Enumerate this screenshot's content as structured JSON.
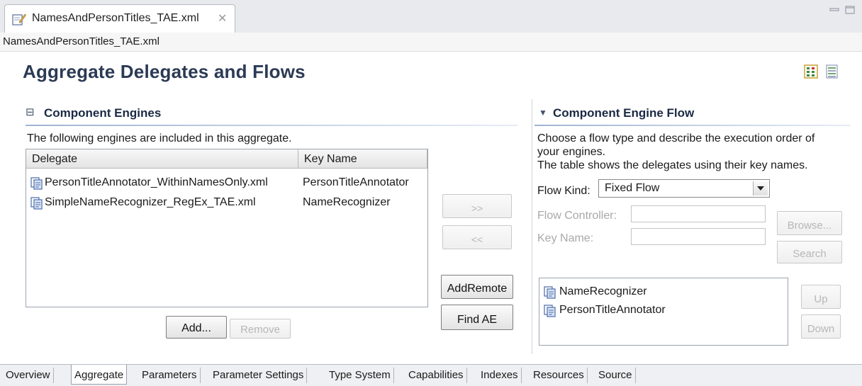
{
  "editor_tab": {
    "label": "NamesAndPersonTitles_TAE.xml",
    "close_glyph": "✕"
  },
  "path": "NamesAndPersonTitles_TAE.xml",
  "page_title": "Aggregate Delegates and Flows",
  "component_engines": {
    "toggle_glyph": "⊟",
    "title": "Component Engines",
    "description": "The following engines are included in this aggregate.",
    "columns": [
      "Delegate",
      "Key Name"
    ],
    "rows": [
      {
        "delegate": "PersonTitleAnnotator_WithinNamesOnly.xml",
        "key": "PersonTitleAnnotator",
        "icon": "descriptor-icon"
      },
      {
        "delegate": "SimpleNameRecognizer_RegEx_TAE.xml",
        "key": "NameRecognizer",
        "icon": "descriptor-icon"
      }
    ],
    "add_label": "Add...",
    "remove_label": "Remove"
  },
  "middle_buttons": {
    "move_right": ">>",
    "move_left": "<<",
    "add_remote": "AddRemote",
    "find_ae": "Find AE"
  },
  "engine_flow": {
    "toggle_glyph": "▼",
    "title": "Component Engine Flow",
    "description_line1": "Choose a flow type and describe the execution order of",
    "description_line2": "your engines.",
    "description_line3": "The table shows the delegates using their key names.",
    "flow_kind_label": "Flow Kind:",
    "flow_kind_value": "Fixed Flow",
    "flow_controller_label": "Flow Controller:",
    "key_name_label": "Key Name:",
    "browse_label": "Browse...",
    "search_label": "Search",
    "flow_items": [
      "NameRecognizer",
      "PersonTitleAnnotator"
    ],
    "up_label": "Up",
    "down_label": "Down"
  },
  "bottom_tabs": [
    "Overview",
    "Aggregate",
    "Parameters",
    "Parameter Settings",
    "Type System",
    "Capabilities",
    "Indexes",
    "Resources",
    "Source"
  ],
  "colors": {
    "title": "#2b3a55",
    "tab_strip": "#e9eaee",
    "disabled_text": "#b7b7b7"
  }
}
